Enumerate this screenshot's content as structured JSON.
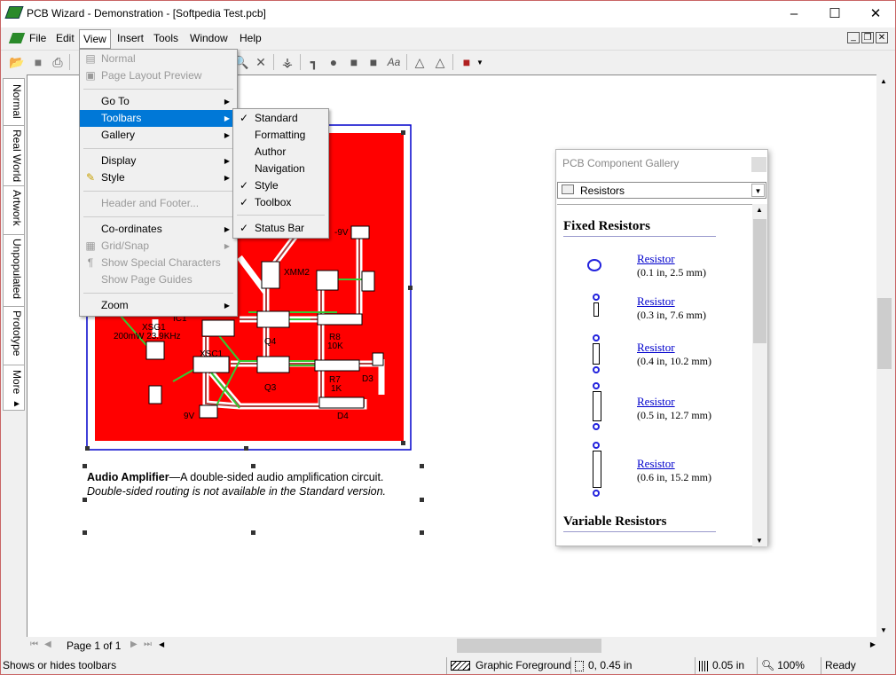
{
  "window": {
    "title": "PCB Wizard - Demonstration - [Softpedia Test.pcb]",
    "minimize": "–",
    "maximize": "☐",
    "close": "✕"
  },
  "menubar": [
    "File",
    "Edit",
    "View",
    "Insert",
    "Tools",
    "Window",
    "Help"
  ],
  "mdi_buttons": [
    "_",
    "❐",
    "✕"
  ],
  "view_menu": [
    {
      "label": "Normal",
      "disabled": true,
      "icon": "normal-view-icon"
    },
    {
      "label": "Page Layout Preview",
      "disabled": true,
      "icon": "page-layout-icon"
    },
    {
      "label": "Go To",
      "submenu": true
    },
    {
      "label": "Toolbars",
      "submenu": true,
      "highlighted": true
    },
    {
      "label": "Gallery",
      "submenu": true
    },
    {
      "label": "Display",
      "submenu": true
    },
    {
      "label": "Style",
      "submenu": true,
      "icon": "brush-icon"
    },
    {
      "label": "Header and Footer...",
      "disabled": true
    },
    {
      "label": "Co-ordinates",
      "submenu": true
    },
    {
      "label": "Grid/Snap",
      "disabled": true,
      "submenu": true,
      "icon": "grid-icon"
    },
    {
      "label": "Show Special Characters",
      "disabled": true,
      "icon": "pilcrow-icon"
    },
    {
      "label": "Show Page Guides",
      "disabled": true
    },
    {
      "label": "Zoom",
      "submenu": true
    }
  ],
  "toolbars_submenu": [
    {
      "label": "Standard",
      "checked": true
    },
    {
      "label": "Formatting",
      "checked": false
    },
    {
      "label": "Author",
      "checked": false
    },
    {
      "label": "Navigation",
      "checked": false
    },
    {
      "label": "Style",
      "checked": true
    },
    {
      "label": "Toolbox",
      "checked": true
    },
    {
      "label": "Status Bar",
      "checked": true
    }
  ],
  "left_tabs": [
    "Normal",
    "Real World",
    "Artwork",
    "Unpopulated",
    "Prototype",
    "More ▸"
  ],
  "pcb": {
    "board_color": "#ff0000",
    "labels": {
      "xsg1": "XSG1",
      "xsg1_spec": "200mW 23.9KHz",
      "ic1": "IC1",
      "xsc1": "XSC1",
      "q4": "Q4",
      "q3": "Q3",
      "r8": "R8",
      "r8_val": "10K",
      "r7": "R7",
      "r7_val": "1K",
      "d3": "D3",
      "d4": "D4",
      "v9": "9V",
      "vneg9": "-9V",
      "xmm2": "XMM2"
    }
  },
  "caption": {
    "title": "Audio Amplifier",
    "body": "—A double-sided audio amplification circuit.",
    "note": "Double-sided routing is not available in the Standard version."
  },
  "gallery": {
    "title": "PCB Component Gallery",
    "category": "Resistors",
    "sections": [
      {
        "heading": "Fixed Resistors"
      },
      {
        "heading": "Variable Resistors"
      }
    ],
    "items": [
      {
        "name": "Resistor",
        "spec": "(0.1 in, 2.5 mm)"
      },
      {
        "name": "Resistor",
        "spec": "(0.3 in, 7.6 mm)"
      },
      {
        "name": "Resistor",
        "spec": "(0.4 in, 10.2 mm)"
      },
      {
        "name": "Resistor",
        "spec": "(0.5 in, 12.7 mm)"
      },
      {
        "name": "Resistor",
        "spec": "(0.6 in, 15.2 mm)"
      }
    ]
  },
  "navigation": {
    "page": "Page 1 of 1"
  },
  "statusbar": {
    "message": "Shows or hides toolbars",
    "layer": "Graphic Foreground",
    "coords": "0, 0.45 in",
    "grid": "0.05 in",
    "zoom": "100%",
    "state": "Ready"
  }
}
